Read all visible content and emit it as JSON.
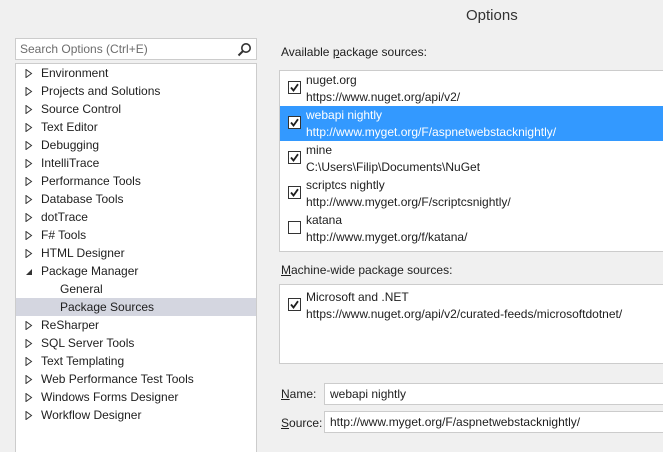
{
  "window": {
    "title": "Options"
  },
  "search": {
    "placeholder": "Search Options (Ctrl+E)"
  },
  "tree": {
    "items": [
      {
        "label": "Environment"
      },
      {
        "label": "Projects and Solutions"
      },
      {
        "label": "Source Control"
      },
      {
        "label": "Text Editor"
      },
      {
        "label": "Debugging"
      },
      {
        "label": "IntelliTrace"
      },
      {
        "label": "Performance Tools"
      },
      {
        "label": "Database Tools"
      },
      {
        "label": "dotTrace"
      },
      {
        "label": "F# Tools"
      },
      {
        "label": "HTML Designer"
      },
      {
        "label": "Package Manager"
      },
      {
        "label": "General"
      },
      {
        "label": "Package Sources"
      },
      {
        "label": "ReSharper"
      },
      {
        "label": "SQL Server Tools"
      },
      {
        "label": "Text Templating"
      },
      {
        "label": "Web Performance Test Tools"
      },
      {
        "label": "Windows Forms Designer"
      },
      {
        "label": "Workflow Designer"
      }
    ]
  },
  "available": {
    "label_pre": "Available ",
    "label_key": "p",
    "label_post": "ackage sources:",
    "sources": [
      {
        "name": "nuget.org",
        "url": "https://www.nuget.org/api/v2/",
        "checked": true
      },
      {
        "name": "webapi nightly",
        "url": "http://www.myget.org/F/aspnetwebstacknightly/",
        "checked": true
      },
      {
        "name": "mine",
        "url": "C:\\Users\\Filip\\Documents\\NuGet",
        "checked": true
      },
      {
        "name": "scriptcs nightly",
        "url": "http://www.myget.org/F/scriptcsnightly/",
        "checked": true
      },
      {
        "name": "katana",
        "url": "http://www.myget.org/f/katana/",
        "checked": false
      }
    ]
  },
  "machine": {
    "label_key": "M",
    "label_post": "achine-wide package sources:",
    "sources": [
      {
        "name": "Microsoft and .NET",
        "url": "https://www.nuget.org/api/v2/curated-feeds/microsoftdotnet/",
        "checked": true
      }
    ]
  },
  "form": {
    "name_key": "N",
    "name_post": "ame:",
    "name_value": "webapi nightly",
    "source_key": "S",
    "source_post": "ource:",
    "source_value": "http://www.myget.org/F/aspnetwebstacknightly/"
  },
  "colors": {
    "selection": "#3399ff",
    "tree_selection": "#d4d6e0"
  },
  "icons": {
    "search": "search-icon",
    "expand": "expand-arrow-icon",
    "check": "check-icon"
  }
}
